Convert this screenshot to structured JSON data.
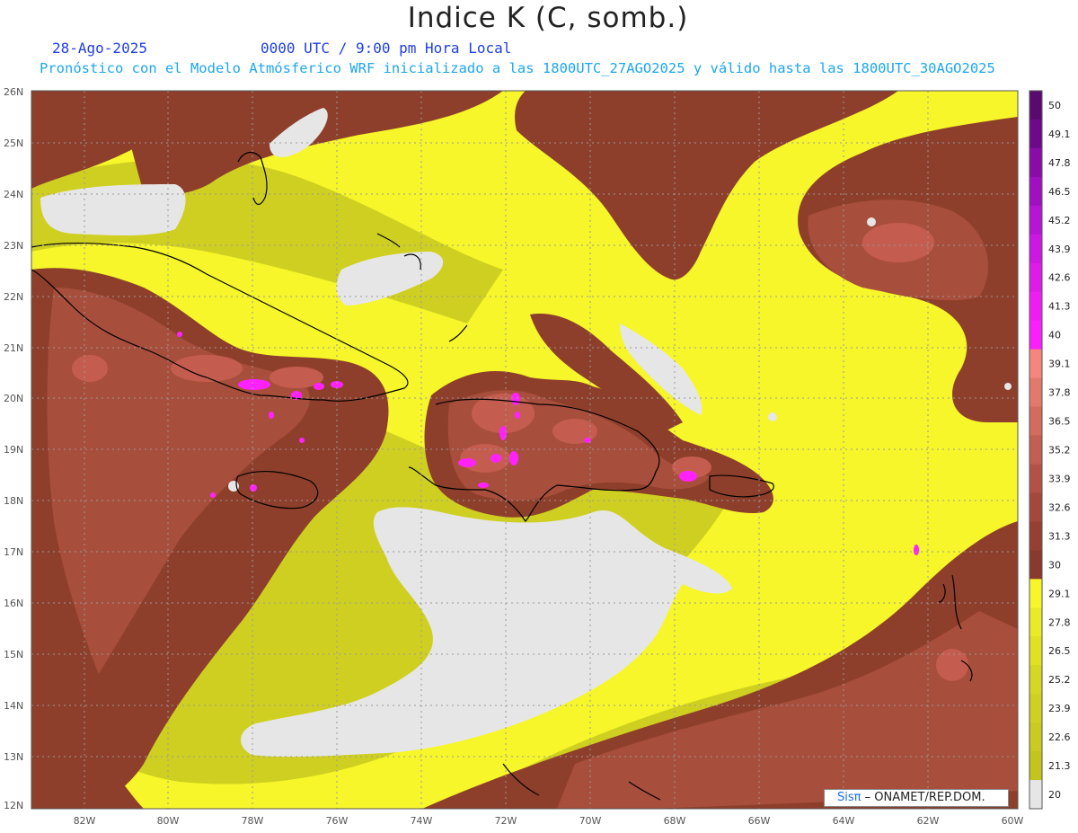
{
  "header": {
    "title": "Indice K (C, somb.)",
    "date": "28-Ago-2025",
    "valid_time": "0000 UTC / 9:00 pm Hora Local",
    "forecast_text": "Pronóstico con el Modelo Atmósferico WRF inicializado a las 1800UTC_27AGO2025 y válido hasta las  1800UTC_30AGO2025"
  },
  "map": {
    "lat_labels": [
      "26N",
      "25N",
      "24N",
      "23N",
      "22N",
      "21N",
      "20N",
      "19N",
      "18N",
      "17N",
      "16N",
      "15N",
      "14N",
      "13N",
      "12N"
    ],
    "lon_labels": [
      "82W",
      "80W",
      "78W",
      "76W",
      "74W",
      "72W",
      "70W",
      "68W",
      "66W",
      "64W",
      "62W",
      "60W"
    ],
    "colors": {
      "base_yellow": "#f6f62a",
      "olive": "#cfcf22",
      "brown": "#8e3f2b",
      "brown_mid": "#a84e3c",
      "brown_light": "#c45d4f",
      "salmon": "#e07868",
      "magenta": "#ff22ff",
      "no_data": "#e6e6e6",
      "coast": "#000000"
    }
  },
  "colorbar": {
    "levels": [
      "50",
      "49.1",
      "47.8",
      "46.5",
      "45.2",
      "43.9",
      "42.6",
      "41.3",
      "40",
      "39.1",
      "37.8",
      "36.5",
      "35.2",
      "33.9",
      "32.6",
      "31.3",
      "30",
      "29.1",
      "27.8",
      "26.5",
      "25.2",
      "23.9",
      "22.6",
      "21.3",
      "20"
    ],
    "colors": [
      "#5a0a6e",
      "#6e0a8a",
      "#8a0ca8",
      "#a010c0",
      "#b814d4",
      "#cc18e0",
      "#de1ce8",
      "#ee1ef2",
      "#fa20fc",
      "#f4867e",
      "#e2796d",
      "#d36b5e",
      "#c35e52",
      "#b25246",
      "#a3483b",
      "#954033",
      "#8a3a2c",
      "#f6f62a",
      "#eaea26",
      "#e0e024",
      "#d6d624",
      "#d0d024",
      "#caca22",
      "#c4c41e",
      "#e6e6e6"
    ]
  },
  "credit": {
    "brand": "Sisπ",
    "text": "– ONAMET/REP.DOM."
  }
}
